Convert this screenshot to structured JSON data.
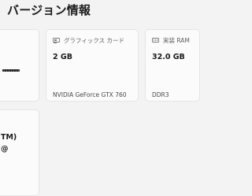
{
  "header": {
    "title": "バージョン情報"
  },
  "cards": {
    "gpu": {
      "label": "グラフィックス カード",
      "value": "2 GB",
      "subtitle": "NVIDIA GeForce GTX 760",
      "icon": "gpu-card-icon"
    },
    "ram": {
      "label": "実装 RAM",
      "value": "32.0 GB",
      "subtitle": "DDR3",
      "icon": "ram-icon"
    },
    "cpu": {
      "line1": "TM)",
      "line2": "@"
    }
  },
  "colors": {
    "background": "#f3f3f3",
    "card": "#fbfbfb",
    "border": "#e5e5e5"
  }
}
